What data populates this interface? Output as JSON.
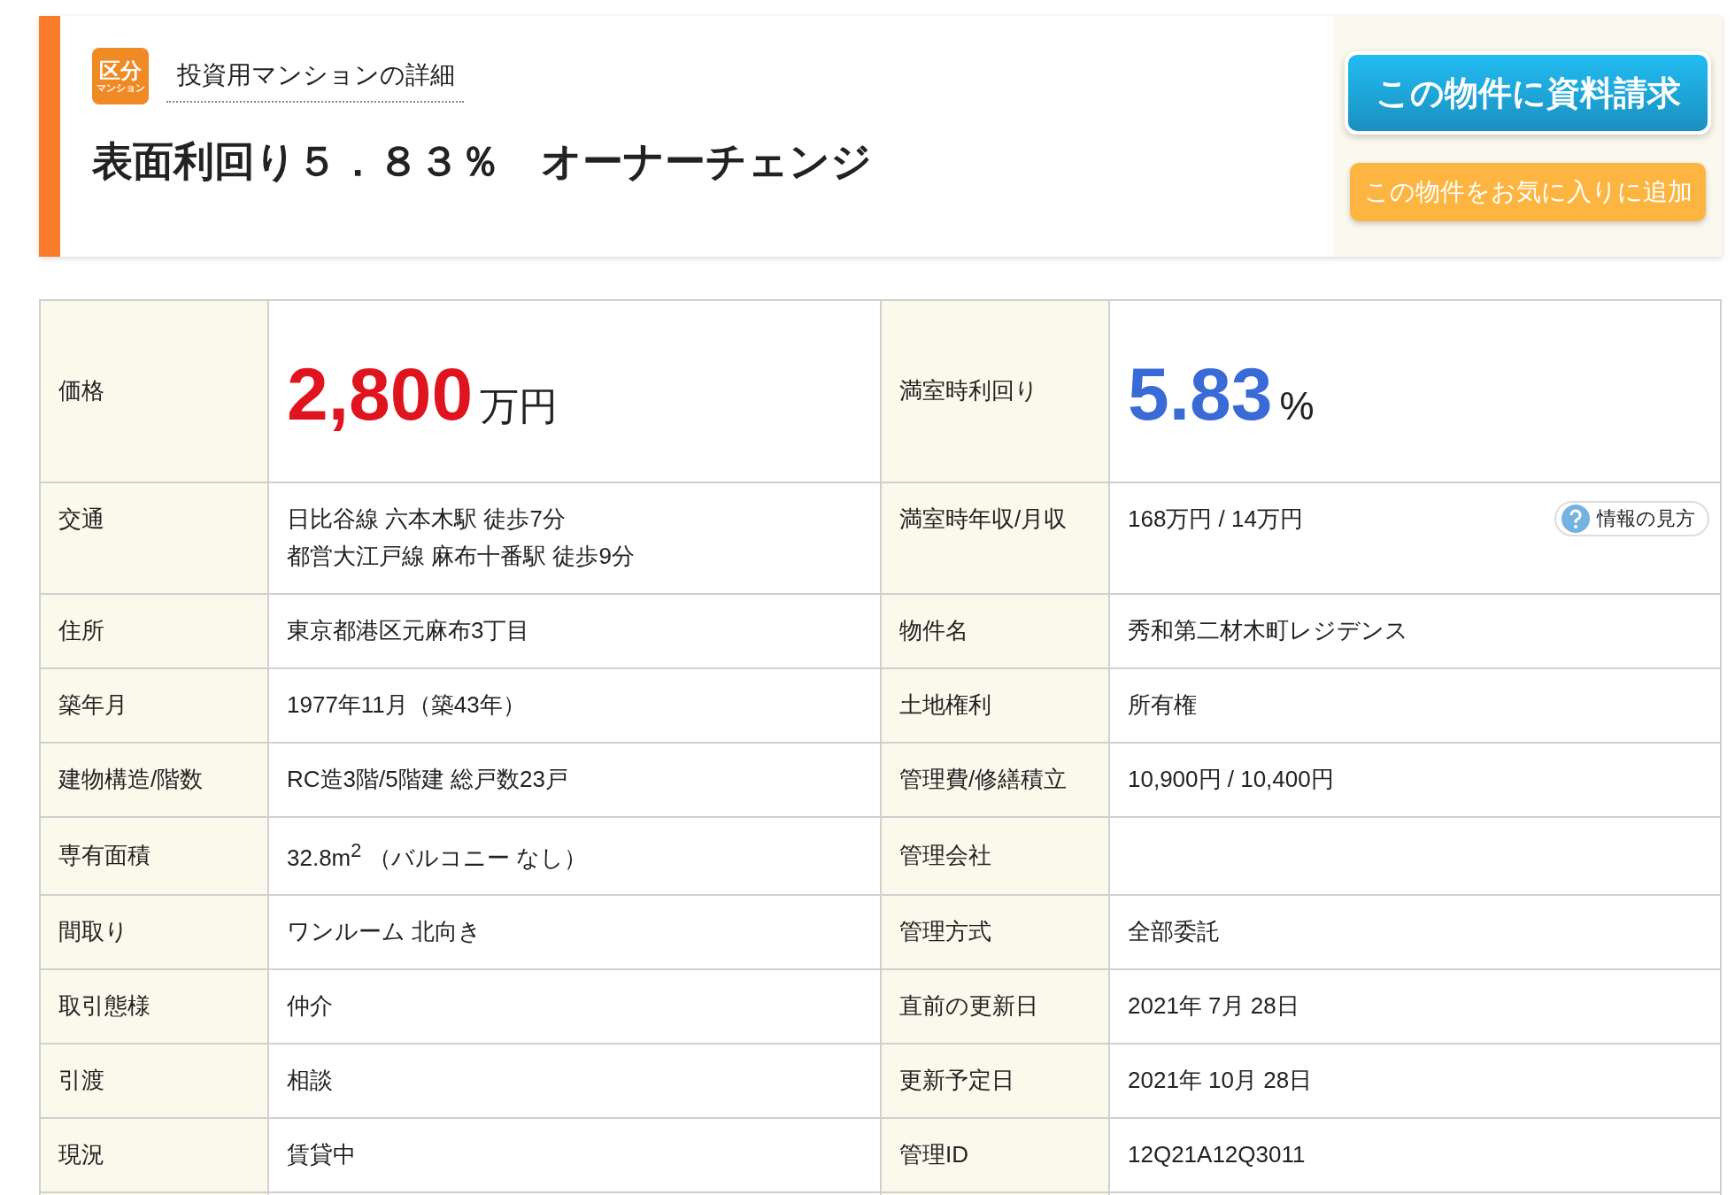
{
  "header": {
    "badge": {
      "top": "区分",
      "bottom": "マンション"
    },
    "category": "投資用マンションの詳細",
    "title": "表面利回り５．８３％　オーナーチェンジ",
    "buttons": [
      {
        "kind": "primary",
        "label": "この物件に資料請求"
      },
      {
        "kind": "secondary",
        "label": "この物件をお気に入りに追加"
      }
    ]
  },
  "table": {
    "rows": [
      [
        {
          "label": "価格",
          "kind": "price",
          "value": "2,800",
          "unit": "万円"
        },
        {
          "label": "満室時利回り",
          "kind": "yield",
          "value": "5.83",
          "unit": "%"
        }
      ],
      [
        {
          "label": "交通",
          "kind": "lines",
          "lines": [
            "日比谷線 六本木駅 徒歩7分",
            "都営大江戸線 麻布十番駅 徒歩9分"
          ]
        },
        {
          "label": "満室時年収/月収",
          "kind": "help",
          "value": "168万円 / 14万円",
          "help": "情報の見方"
        }
      ],
      [
        {
          "label": "住所",
          "value": "東京都港区元麻布3丁目"
        },
        {
          "label": "物件名",
          "value": "秀和第二材木町レジデンス"
        }
      ],
      [
        {
          "label": "築年月",
          "value": "1977年11月（築43年）"
        },
        {
          "label": "土地権利",
          "value": "所有権"
        }
      ],
      [
        {
          "label": "建物構造/階数",
          "value": "RC造3階/5階建 総戸数23戸"
        },
        {
          "label": "管理費/修繕積立",
          "value": "10,900円 / 10,400円"
        }
      ],
      [
        {
          "label": "専有面積",
          "value": "32.8m$^{2}$ （バルコニー なし）"
        },
        {
          "label": "管理会社"
        }
      ],
      [
        {
          "label": "間取り",
          "value": "ワンルーム 北向き"
        },
        {
          "label": "管理方式",
          "value": "全部委託"
        }
      ],
      [
        {
          "label": "取引態様",
          "value": "仲介"
        },
        {
          "label": "直前の更新日",
          "value": "2021年 7月 28日"
        }
      ],
      [
        {
          "label": "引渡",
          "value": "相談"
        },
        {
          "label": "更新予定日",
          "value": "2021年 10月 28日"
        }
      ],
      [
        {
          "label": "現況",
          "value": "賃貸中"
        },
        {
          "label": "管理ID",
          "value": "12Q21A12Q3011"
        }
      ]
    ]
  }
}
